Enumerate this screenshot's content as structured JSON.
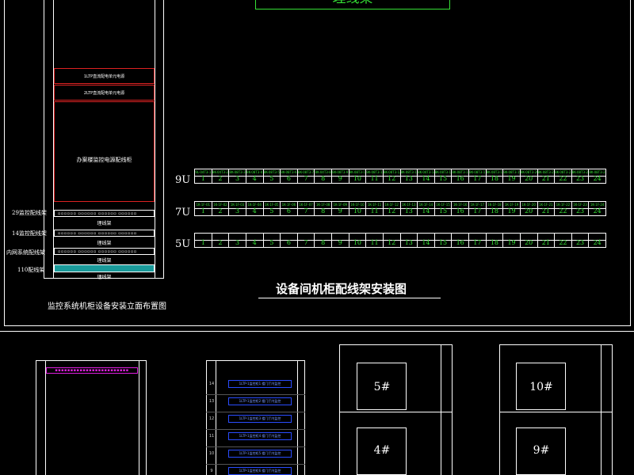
{
  "top_title_box": "理线架",
  "left_rack": {
    "red_boxes": [
      {
        "label": "1LTP直流配电单元电源"
      },
      {
        "label": "2LTP直流配电单元电源"
      },
      {
        "label": "办案楼监控电源配线柜"
      }
    ],
    "panels": [
      {
        "label": "29监控配线架",
        "manager": "理线架"
      },
      {
        "label": "14监控配线架",
        "manager": "理线架"
      },
      {
        "label": "内网系统配线架",
        "manager": "理线架"
      },
      {
        "label": "110配线架",
        "manager": "理线架"
      }
    ],
    "caption": "监控系统机柜设备安装立面布置图"
  },
  "patch_rows": [
    {
      "unit": "9U",
      "tags": [
        "9L-04T3-1",
        "8K-04T3-2",
        "8K-08T3-3",
        "8K-08T3-4",
        "8K-08T3-5",
        "8K-08T3-6",
        "8K-08T3-7",
        "8K-04T3-8",
        "8K-08T3-9",
        "8K-08T3-10",
        "8K-08T3-11",
        "8K-08T3-12",
        "8K-08T3-13",
        "8K-04T3-14",
        "8K-08T3-15",
        "8K-08T3-16",
        "8K-08T3-17",
        "8K-08T3-18",
        "8K-08T3-19",
        "8K-08T3-20",
        "8K-08T3-21",
        "8K-08T3-22",
        "8K-08T3-23",
        "8K-08T3-24"
      ],
      "numbers": [
        "1",
        "2",
        "3",
        "4",
        "5",
        "6",
        "7",
        "8",
        "9",
        "10",
        "11",
        "12",
        "13",
        "14",
        "15",
        "16",
        "17",
        "18",
        "19",
        "20",
        "21",
        "22",
        "23",
        "24"
      ]
    },
    {
      "unit": "7U",
      "tags": [
        "1K-1F-01",
        "1K-1F-02",
        "1K-1F-03",
        "1K-1F-04",
        "1K-1F-05",
        "1K-1F-06",
        "1K-1F-07",
        "1K-1F-08",
        "1K-1F-09",
        "1K-1F-10",
        "1K-1F-11",
        "1K-1F-12",
        "1K-1F-13",
        "1K-1F-14",
        "1K-1F-15",
        "1K-1F-16",
        "1K-1F-17",
        "1K-1F-18",
        "1K-1F-19",
        "1K-1F-20",
        "1K-1F-21",
        "1K-1F-22",
        "1K-1F-23",
        "1K-1F-24"
      ],
      "numbers": [
        "1",
        "2",
        "3",
        "4",
        "5",
        "6",
        "7",
        "8",
        "9",
        "10",
        "11",
        "12",
        "13",
        "14",
        "15",
        "16",
        "17",
        "18",
        "19",
        "20",
        "21",
        "22",
        "23",
        "24"
      ]
    },
    {
      "unit": "5U",
      "tags": [],
      "numbers": [
        "1",
        "2",
        "3",
        "4",
        "5",
        "6",
        "7",
        "8",
        "9",
        "10",
        "11",
        "12",
        "13",
        "14",
        "15",
        "16",
        "17",
        "18",
        "19",
        "20",
        "21",
        "22",
        "23",
        "24"
      ]
    }
  ],
  "main_title": "设备间机柜配线架安装图",
  "bottom": {
    "rack_ids": [
      "5#",
      "4#",
      "10#",
      "9#"
    ],
    "blue_items": [
      "1LTP-1监控柜1 楼门厅内监控",
      "1LTP-1监控柜2 楼门厅内监控",
      "1LTP-1监控柜3 楼门厅内监控",
      "1LTP-1监控柜4 楼门厅内监控",
      "1LTP-1监控柜5 楼门厅内监控",
      "1LTP-1监控柜6 楼门厅内监控"
    ],
    "row_numbers": [
      "14",
      "13",
      "12",
      "11",
      "10",
      "9"
    ]
  },
  "colors": {
    "green": "#35e035",
    "red": "#d22222",
    "blue": "#2a4cff",
    "magenta": "#e020e0",
    "teal": "#1a9a9a"
  }
}
